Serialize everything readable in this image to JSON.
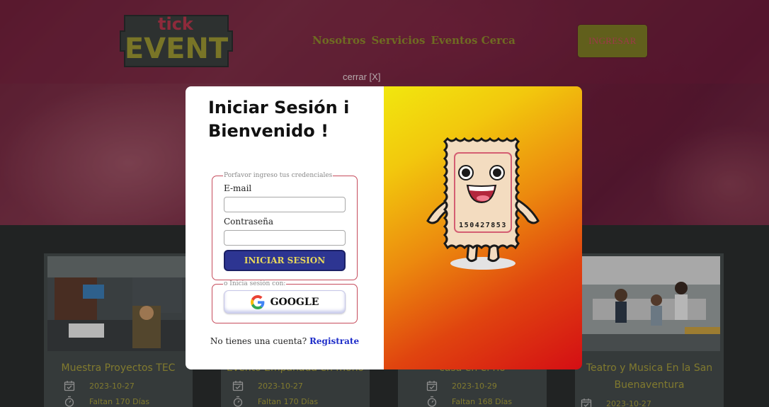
{
  "brand": {
    "logo_top": "tick",
    "logo_bottom": "EVENT"
  },
  "nav": {
    "links": [
      "Nosotros",
      "Servicios",
      "Eventos Cerca"
    ],
    "login_button": "INGRESAR"
  },
  "close_link": "cerrar [X]",
  "cards": [
    {
      "title_lines": [
        "Muestra Proyectos TEC",
        ""
      ],
      "date": "2023-10-27",
      "remaining": "Faltan 170 Días"
    },
    {
      "title_lines": [
        "Evento Empanada en mono",
        ""
      ],
      "date": "2023-10-27",
      "remaining": "Faltan 170 Días"
    },
    {
      "title_lines": [
        "casa en el rio",
        ""
      ],
      "date": "2023-10-29",
      "remaining": "Faltan 168 Días"
    },
    {
      "title_lines": [
        "Teatro y Musica En la San",
        "Buenaventura"
      ],
      "date": "2023-10-27",
      "remaining": ""
    }
  ],
  "modal": {
    "title_line1": "Iniciar Sesión i",
    "title_line2": "Bienvenido !",
    "credentials_legend": "Porfavor ingreso tus credenciales",
    "email_label": "E-mail",
    "email_value": "",
    "password_label": "Contraseña",
    "password_value": "",
    "submit_label": "INICIAR SESION",
    "social_legend": "o Inicia sesión con:",
    "google_label": "GOOGLE",
    "signup_prompt": "No tienes una cuenta?",
    "signup_link": "Registrate",
    "ticket_number": "150427853"
  },
  "colors": {
    "accent_olive": "#8f8a2c",
    "modal_button": "#2d3592",
    "modal_border": "#c64c5c",
    "gradient_start": "#f1e70e",
    "gradient_end": "#d40e14"
  },
  "icons": [
    "calendar-check-icon",
    "stopwatch-icon",
    "google-icon",
    "ticket-mascot"
  ]
}
